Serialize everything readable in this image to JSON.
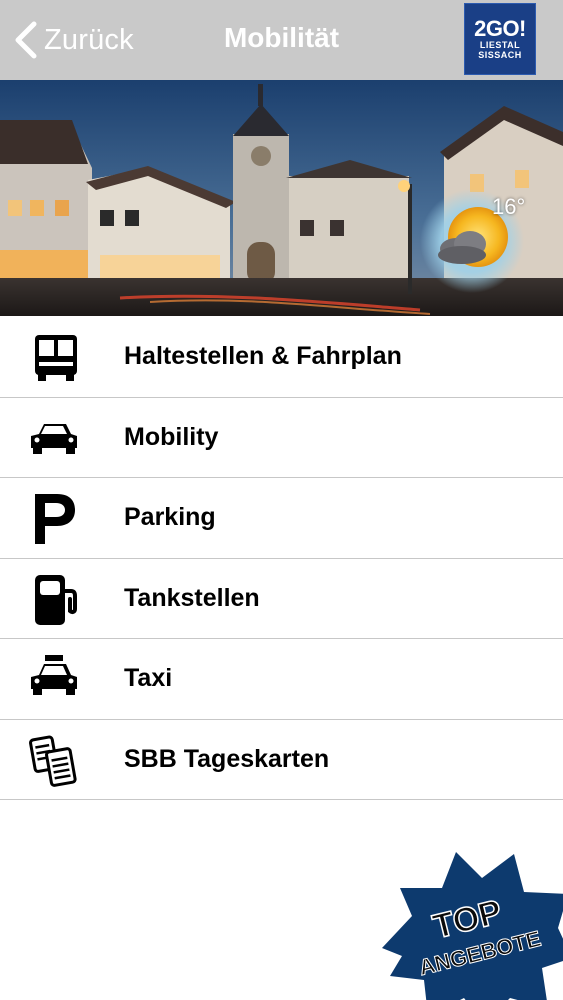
{
  "nav": {
    "back_label": "Zurück",
    "title": "Mobilität",
    "logo_main": "2GO!",
    "logo_sub_1": "LIESTAL",
    "logo_sub_2": "SISSACH"
  },
  "weather": {
    "temperature": "16°",
    "icon": "partly-cloudy-icon"
  },
  "menu": [
    {
      "label": "Haltestellen & Fahrplan",
      "icon": "bus-icon"
    },
    {
      "label": "Mobility",
      "icon": "car-icon"
    },
    {
      "label": "Parking",
      "icon": "parking-icon"
    },
    {
      "label": "Tankstellen",
      "icon": "fuel-pump-icon"
    },
    {
      "label": "Taxi",
      "icon": "taxi-icon"
    },
    {
      "label": "SBB Tageskarten",
      "icon": "tickets-icon"
    }
  ],
  "badge": {
    "line1": "TOP",
    "line2": "ANGEBOTE"
  },
  "colors": {
    "navbar": "#c9c9c9",
    "logo": "#1a3f86",
    "badge": "#0d3a6e"
  }
}
